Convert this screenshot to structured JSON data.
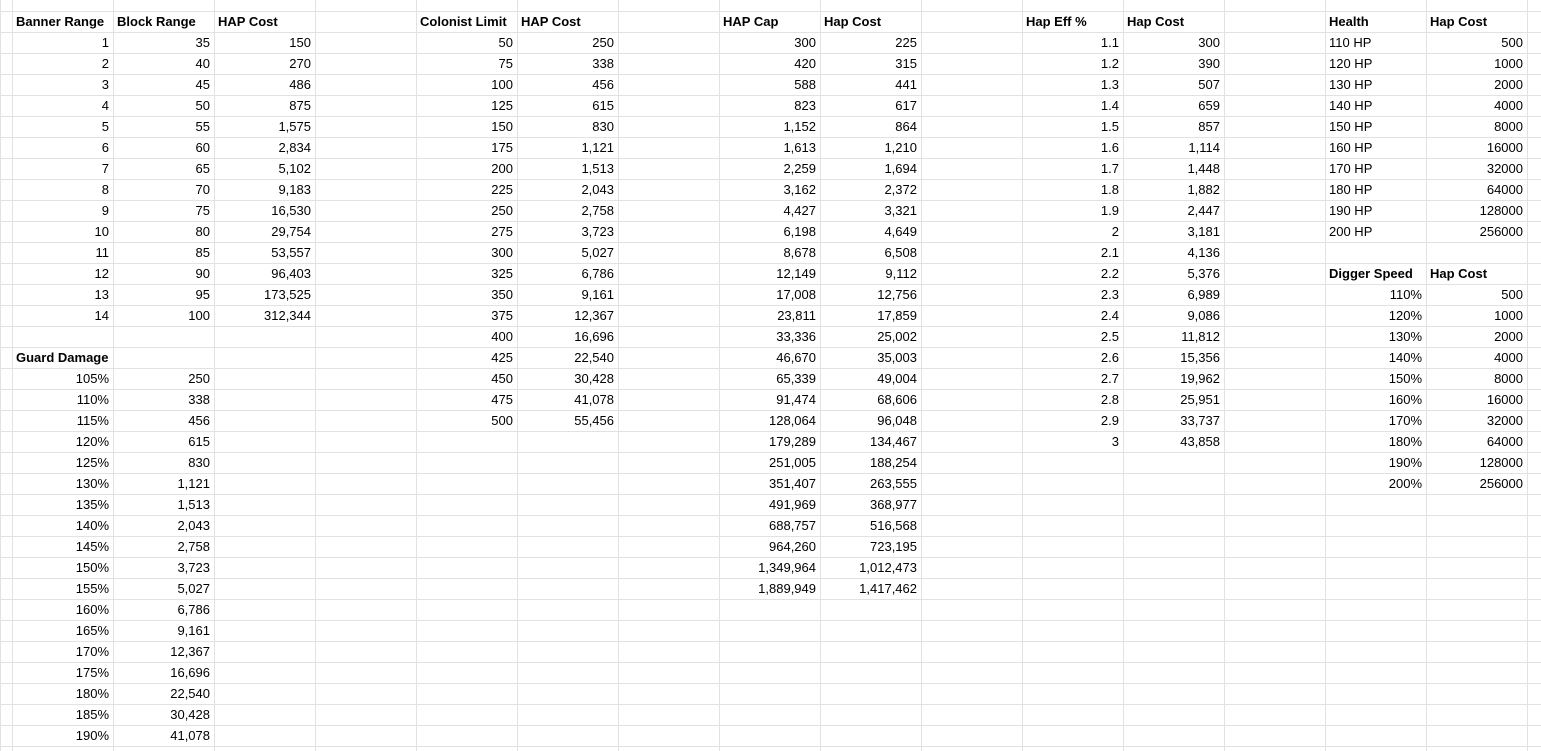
{
  "headers": {
    "banner_range": "Banner Range",
    "block_range": "Block Range",
    "banner_hap_cost": "HAP Cost",
    "colonist_limit": "Colonist Limit",
    "colonist_hap_cost": "HAP Cost",
    "hap_cap": "HAP Cap",
    "hap_cap_cost": "Hap Cost",
    "hap_eff": "Hap Eff %",
    "hap_eff_cost": "Hap Cost",
    "health": "Health",
    "health_cost": "Hap Cost",
    "guard_damage": "Guard Damage",
    "digger_speed": "Digger Speed",
    "digger_cost": "Hap Cost"
  },
  "tables": {
    "banner": {
      "banner_range": [
        "1",
        "2",
        "3",
        "4",
        "5",
        "6",
        "7",
        "8",
        "9",
        "10",
        "11",
        "12",
        "13",
        "14"
      ],
      "block_range": [
        "35",
        "40",
        "45",
        "50",
        "55",
        "60",
        "65",
        "70",
        "75",
        "80",
        "85",
        "90",
        "95",
        "100"
      ],
      "hap_cost": [
        "150",
        "270",
        "486",
        "875",
        "1,575",
        "2,834",
        "5,102",
        "9,183",
        "16,530",
        "29,754",
        "53,557",
        "96,403",
        "173,525",
        "312,344"
      ]
    },
    "guard": {
      "damage": [
        "105%",
        "110%",
        "115%",
        "120%",
        "125%",
        "130%",
        "135%",
        "140%",
        "145%",
        "150%",
        "155%",
        "160%",
        "165%",
        "170%",
        "175%",
        "180%",
        "185%",
        "190%"
      ],
      "cost": [
        "250",
        "338",
        "456",
        "615",
        "830",
        "1,121",
        "1,513",
        "2,043",
        "2,758",
        "3,723",
        "5,027",
        "6,786",
        "9,161",
        "12,367",
        "16,696",
        "22,540",
        "30,428",
        "41,078"
      ]
    },
    "colonist": {
      "limit": [
        "50",
        "75",
        "100",
        "125",
        "150",
        "175",
        "200",
        "225",
        "250",
        "275",
        "300",
        "325",
        "350",
        "375",
        "400",
        "425",
        "450",
        "475",
        "500"
      ],
      "cost": [
        "250",
        "338",
        "456",
        "615",
        "830",
        "1,121",
        "1,513",
        "2,043",
        "2,758",
        "3,723",
        "5,027",
        "6,786",
        "9,161",
        "12,367",
        "16,696",
        "22,540",
        "30,428",
        "41,078",
        "55,456"
      ]
    },
    "hapcap": {
      "cap": [
        "300",
        "420",
        "588",
        "823",
        "1,152",
        "1,613",
        "2,259",
        "3,162",
        "4,427",
        "6,198",
        "8,678",
        "12,149",
        "17,008",
        "23,811",
        "33,336",
        "46,670",
        "65,339",
        "91,474",
        "128,064",
        "179,289",
        "251,005",
        "351,407",
        "491,969",
        "688,757",
        "964,260",
        "1,349,964",
        "1,889,949"
      ],
      "cost": [
        "225",
        "315",
        "441",
        "617",
        "864",
        "1,210",
        "1,694",
        "2,372",
        "3,321",
        "4,649",
        "6,508",
        "9,112",
        "12,756",
        "17,859",
        "25,002",
        "35,003",
        "49,004",
        "68,606",
        "96,048",
        "134,467",
        "188,254",
        "263,555",
        "368,977",
        "516,568",
        "723,195",
        "1,012,473",
        "1,417,462"
      ]
    },
    "hapeff": {
      "eff": [
        "1.1",
        "1.2",
        "1.3",
        "1.4",
        "1.5",
        "1.6",
        "1.7",
        "1.8",
        "1.9",
        "2",
        "2.1",
        "2.2",
        "2.3",
        "2.4",
        "2.5",
        "2.6",
        "2.7",
        "2.8",
        "2.9",
        "3"
      ],
      "cost": [
        "300",
        "390",
        "507",
        "659",
        "857",
        "1,114",
        "1,448",
        "1,882",
        "2,447",
        "3,181",
        "4,136",
        "5,376",
        "6,989",
        "9,086",
        "11,812",
        "15,356",
        "19,962",
        "25,951",
        "33,737",
        "43,858"
      ]
    },
    "health": {
      "hp": [
        "110 HP",
        "120 HP",
        "130 HP",
        "140 HP",
        "150 HP",
        "160 HP",
        "170 HP",
        "180 HP",
        "190 HP",
        "200 HP"
      ],
      "cost": [
        "500",
        "1000",
        "2000",
        "4000",
        "8000",
        "16000",
        "32000",
        "64000",
        "128000",
        "256000"
      ]
    },
    "digger": {
      "speed": [
        "110%",
        "120%",
        "130%",
        "140%",
        "150%",
        "160%",
        "170%",
        "180%",
        "190%",
        "200%"
      ],
      "cost": [
        "500",
        "1000",
        "2000",
        "4000",
        "8000",
        "16000",
        "32000",
        "64000",
        "128000",
        "256000"
      ]
    }
  }
}
